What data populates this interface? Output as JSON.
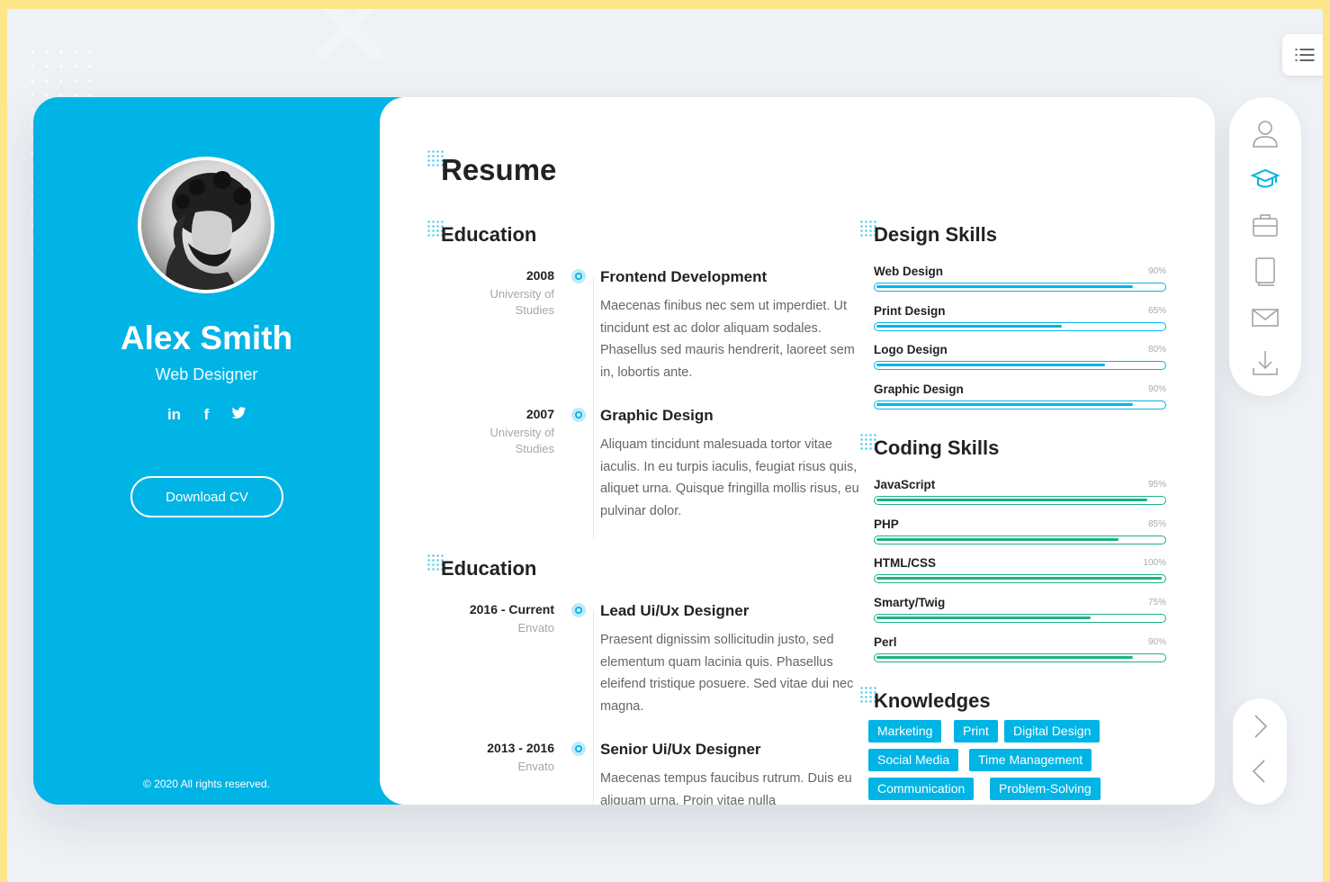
{
  "profile": {
    "name": "Alex Smith",
    "role": "Web Designer",
    "socials": [
      "in",
      "f",
      "t"
    ],
    "download_label": "Download CV",
    "copyright": "© 2020 All rights reserved."
  },
  "resume": {
    "title": "Resume",
    "education_heading": "Education",
    "education": [
      {
        "year": "2008",
        "place": "University of Studies",
        "title": "Frontend Development",
        "desc": "Maecenas finibus nec sem ut imperdiet. Ut tincidunt est ac dolor aliquam sodales. Phasellus sed mauris hendrerit, laoreet sem in, lobortis ante."
      },
      {
        "year": "2007",
        "place": "University of Studies",
        "title": "Graphic Design",
        "desc": "Aliquam tincidunt malesuada tortor vitae iaculis. In eu turpis iaculis, feugiat risus quis, aliquet urna. Quisque fringilla mollis risus, eu pulvinar dolor."
      }
    ],
    "experience_heading": "Education",
    "experience": [
      {
        "year": "2016 - Current",
        "place": "Envato",
        "title": "Lead Ui/Ux Designer",
        "desc": "Praesent dignissim sollicitudin justo, sed elementum quam lacinia quis. Phasellus eleifend tristique posuere. Sed vitae dui nec magna."
      },
      {
        "year": "2013 - 2016",
        "place": "Envato",
        "title": "Senior Ui/Ux Designer",
        "desc": "Maecenas tempus faucibus rutrum. Duis eu aliquam urna. Proin vitae nulla"
      }
    ]
  },
  "design_skills": {
    "heading": "Design Skills",
    "items": [
      {
        "name": "Web Design",
        "pct_label": "90%",
        "value": 0.9
      },
      {
        "name": "Print Design",
        "pct_label": "65%",
        "value": 0.65
      },
      {
        "name": "Logo Design",
        "pct_label": "80%",
        "value": 0.8
      },
      {
        "name": "Graphic Design",
        "pct_label": "90%",
        "value": 0.9
      }
    ]
  },
  "coding_skills": {
    "heading": "Coding Skills",
    "items": [
      {
        "name": "JavaScript",
        "pct_label": "95%",
        "value": 0.95
      },
      {
        "name": "PHP",
        "pct_label": "85%",
        "value": 0.85
      },
      {
        "name": "HTML/CSS",
        "pct_label": "100%",
        "value": 1.0
      },
      {
        "name": "Smarty/Twig",
        "pct_label": "75%",
        "value": 0.75
      },
      {
        "name": "Perl",
        "pct_label": "90%",
        "value": 0.9
      }
    ]
  },
  "knowledges": {
    "heading": "Knowledges",
    "tags": [
      "Marketing",
      "Print",
      "Digital Design",
      "Social Media",
      "Time Management",
      "Communication",
      "Problem-Solving"
    ]
  },
  "side_nav": {
    "icons": [
      "user-icon",
      "graduation-cap-icon",
      "briefcase-icon",
      "book-icon",
      "mail-icon",
      "download-icon"
    ]
  },
  "arrows": [
    "chevron-right-icon",
    "chevron-left-icon"
  ],
  "colors": {
    "accent": "#00b4e6",
    "coding_bar": "#1db186",
    "page_frame": "#fde68a",
    "background": "#eef1f5"
  }
}
